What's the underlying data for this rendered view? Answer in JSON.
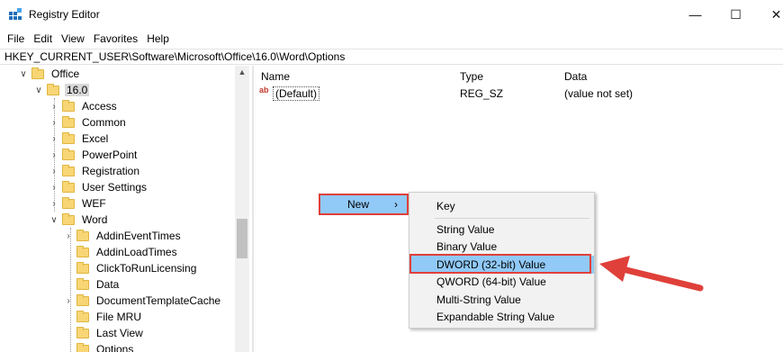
{
  "window": {
    "title": "Registry Editor",
    "minimize_glyph": "—",
    "maximize_glyph": "☐",
    "close_glyph": "✕"
  },
  "menu": [
    "File",
    "Edit",
    "View",
    "Favorites",
    "Help"
  ],
  "address": "HKEY_CURRENT_USER\\Software\\Microsoft\\Office\\16.0\\Word\\Options",
  "tree": {
    "office": "Office",
    "version": "16.0",
    "version_children": [
      "Access",
      "Common",
      "Excel",
      "PowerPoint",
      "Registration",
      "User Settings",
      "WEF"
    ],
    "word": "Word",
    "word_children": [
      "AddinEventTimes",
      "AddinLoadTimes",
      "ClickToRunLicensing",
      "Data",
      "DocumentTemplateCache",
      "File MRU",
      "Last View",
      "Options"
    ]
  },
  "list": {
    "columns": [
      "Name",
      "Type",
      "Data"
    ],
    "rows": [
      {
        "name": "(Default)",
        "type": "REG_SZ",
        "data": "(value not set)"
      }
    ]
  },
  "context_menu": {
    "new_label": "New",
    "new_arrow": "›",
    "submenu": [
      "Key",
      "String Value",
      "Binary Value",
      "DWORD (32-bit) Value",
      "QWORD (64-bit) Value",
      "Multi-String Value",
      "Expandable String Value"
    ],
    "highlighted_item": "DWORD (32-bit) Value"
  },
  "colors": {
    "highlight": "#91c9f7",
    "annotation_red": "#e0403a",
    "folder": "#f8d675"
  },
  "icons": {
    "app": "registry-editor-icon",
    "folder": "folder-icon",
    "value": "string-value-icon"
  }
}
